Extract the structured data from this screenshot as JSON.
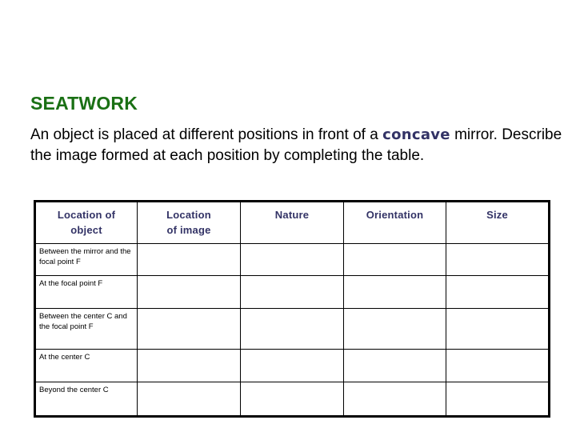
{
  "slide": {
    "title": "SEATWORK",
    "title_color": "#1a7014",
    "accent_color": "#333366",
    "body": {
      "part1": "An object is placed at different positions in front of a ",
      "emphasis": "concave",
      "part2": " mirror. Describe the image formed at each position by completing the table."
    }
  },
  "table": {
    "headers": [
      {
        "line1": "Location of",
        "line2": "object"
      },
      {
        "line1": "Location",
        "line2": "of image"
      },
      {
        "line1": "Nature",
        "line2": ""
      },
      {
        "line1": "Orientation",
        "line2": ""
      },
      {
        "line1": "Size",
        "line2": ""
      }
    ],
    "rows": [
      {
        "location_of_object": "Between the mirror and the focal point F",
        "location_of_image": "",
        "nature": "",
        "orientation": "",
        "size": ""
      },
      {
        "location_of_object": "At the focal point F",
        "location_of_image": "",
        "nature": "",
        "orientation": "",
        "size": ""
      },
      {
        "location_of_object": "Between the center C and the focal point F",
        "location_of_image": "",
        "nature": "",
        "orientation": "",
        "size": ""
      },
      {
        "location_of_object": "At the center C",
        "location_of_image": "",
        "nature": "",
        "orientation": "",
        "size": ""
      },
      {
        "location_of_object": "Beyond the center C",
        "location_of_image": "",
        "nature": "",
        "orientation": "",
        "size": ""
      }
    ]
  }
}
